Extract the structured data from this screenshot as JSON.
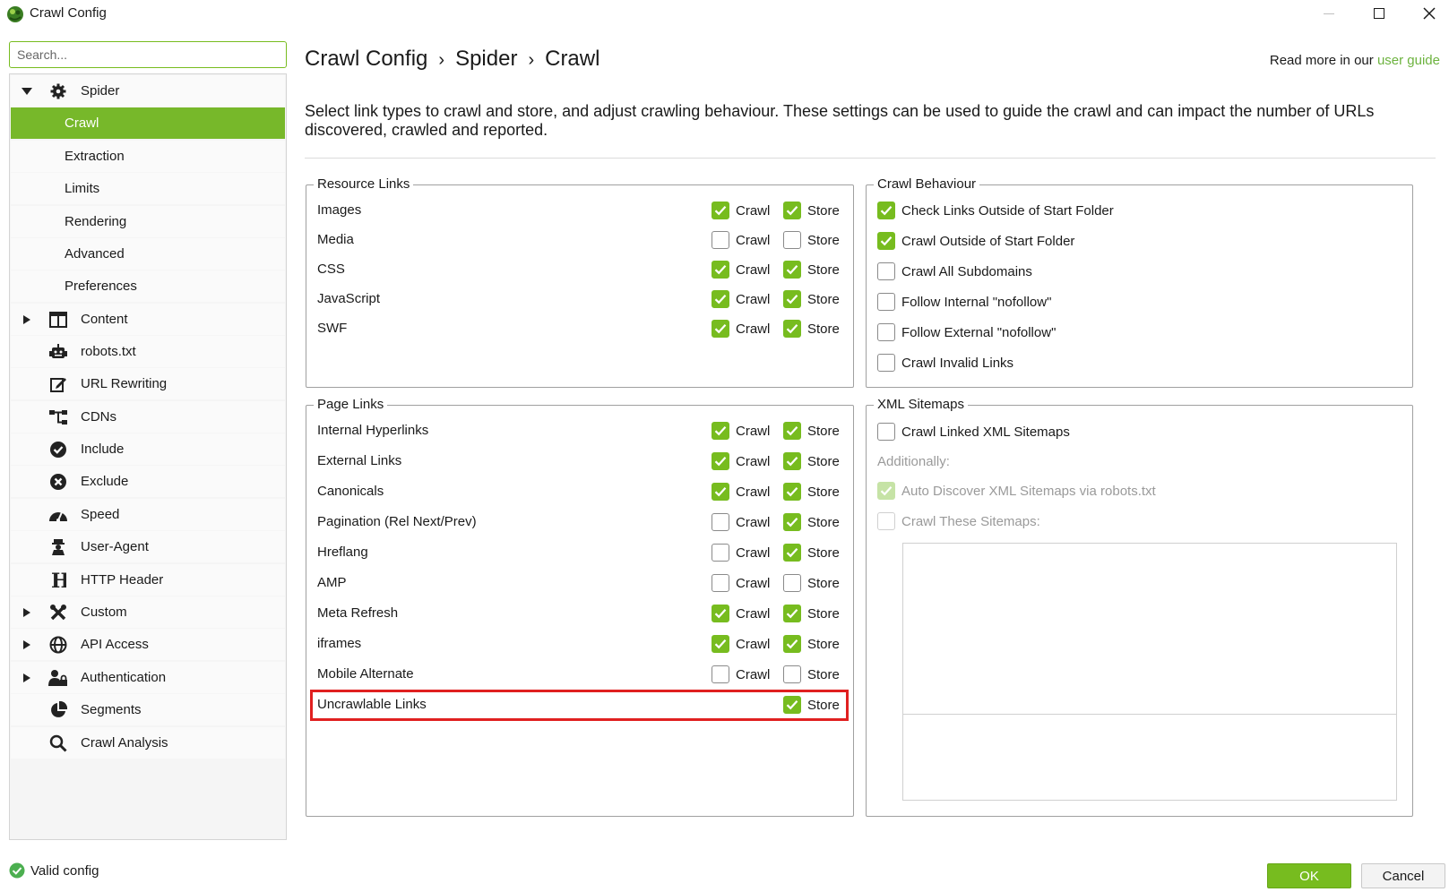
{
  "window": {
    "title": "Crawl Config",
    "controls": [
      "minimize-icon",
      "maximize-icon",
      "close-icon"
    ]
  },
  "search": {
    "placeholder": "Search...",
    "value": ""
  },
  "sidebar": {
    "items": [
      {
        "label": "Spider",
        "icon": "gear-icon",
        "expanded": true,
        "level": 1
      },
      {
        "label": "Crawl",
        "level": 2,
        "selected": true
      },
      {
        "label": "Extraction",
        "level": 2
      },
      {
        "label": "Limits",
        "level": 2
      },
      {
        "label": "Rendering",
        "level": 2
      },
      {
        "label": "Advanced",
        "level": 2
      },
      {
        "label": "Preferences",
        "level": 2
      },
      {
        "label": "Content",
        "icon": "columns-icon",
        "expandable": true,
        "level": 1
      },
      {
        "label": "robots.txt",
        "icon": "robot-icon",
        "level": 1
      },
      {
        "label": "URL Rewriting",
        "icon": "edit-icon",
        "level": 1
      },
      {
        "label": "CDNs",
        "icon": "network-icon",
        "level": 1
      },
      {
        "label": "Include",
        "icon": "check-circle-icon",
        "level": 1
      },
      {
        "label": "Exclude",
        "icon": "x-circle-icon",
        "level": 1
      },
      {
        "label": "Speed",
        "icon": "speedometer-icon",
        "level": 1
      },
      {
        "label": "User-Agent",
        "icon": "user-agent-icon",
        "level": 1
      },
      {
        "label": "HTTP Header",
        "icon": "letter-h-icon",
        "level": 1
      },
      {
        "label": "Custom",
        "icon": "tools-icon",
        "expandable": true,
        "level": 1
      },
      {
        "label": "API Access",
        "icon": "globe-icon",
        "expandable": true,
        "level": 1
      },
      {
        "label": "Authentication",
        "icon": "user-lock-icon",
        "expandable": true,
        "level": 1
      },
      {
        "label": "Segments",
        "icon": "pie-chart-icon",
        "level": 1
      },
      {
        "label": "Crawl Analysis",
        "icon": "magnifier-icon",
        "level": 1
      }
    ]
  },
  "status": {
    "text": "Valid config",
    "icon": "valid-check-icon"
  },
  "header": {
    "breadcrumb": [
      "Crawl Config",
      "Spider",
      "Crawl"
    ],
    "separator": "›",
    "read_more_prefix": "Read more in our",
    "read_more_link": "user guide"
  },
  "description": "Select link types to crawl and store, and adjust crawling behaviour. These settings can be used to guide the crawl and can impact the number of URLs discovered, crawled and reported.",
  "labels": {
    "crawl": "Crawl",
    "store": "Store"
  },
  "resource_links": {
    "title": "Resource Links",
    "rows": [
      {
        "label": "Images",
        "crawl": true,
        "store": true
      },
      {
        "label": "Media",
        "crawl": false,
        "store": false
      },
      {
        "label": "CSS",
        "crawl": true,
        "store": true
      },
      {
        "label": "JavaScript",
        "crawl": true,
        "store": true
      },
      {
        "label": "SWF",
        "crawl": true,
        "store": true
      }
    ]
  },
  "page_links": {
    "title": "Page Links",
    "rows": [
      {
        "label": "Internal Hyperlinks",
        "crawl": true,
        "store": true
      },
      {
        "label": "External Links",
        "crawl": true,
        "store": true
      },
      {
        "label": "Canonicals",
        "crawl": true,
        "store": true
      },
      {
        "label": "Pagination (Rel Next/Prev)",
        "crawl": false,
        "store": true
      },
      {
        "label": "Hreflang",
        "crawl": false,
        "store": true
      },
      {
        "label": "AMP",
        "crawl": false,
        "store": false
      },
      {
        "label": "Meta Refresh",
        "crawl": true,
        "store": true
      },
      {
        "label": "iframes",
        "crawl": true,
        "store": true
      },
      {
        "label": "Mobile Alternate",
        "crawl": false,
        "store": false
      },
      {
        "label": "Uncrawlable Links",
        "crawl": null,
        "store": true,
        "highlighted": true
      }
    ]
  },
  "crawl_behaviour": {
    "title": "Crawl Behaviour",
    "options": [
      {
        "label": "Check Links Outside of Start Folder",
        "checked": true
      },
      {
        "label": "Crawl Outside of Start Folder",
        "checked": true
      },
      {
        "label": "Crawl All Subdomains",
        "checked": false
      },
      {
        "label": "Follow Internal \"nofollow\"",
        "checked": false
      },
      {
        "label": "Follow External \"nofollow\"",
        "checked": false
      },
      {
        "label": "Crawl Invalid Links",
        "checked": false
      }
    ]
  },
  "xml_sitemaps": {
    "title": "XML Sitemaps",
    "crawl_linked": {
      "label": "Crawl Linked XML Sitemaps",
      "checked": false
    },
    "additionally": "Additionally:",
    "auto_discover": {
      "label": "Auto Discover XML Sitemaps via robots.txt",
      "checked": true,
      "disabled": true
    },
    "crawl_these": {
      "label": "Crawl These Sitemaps:",
      "checked": false,
      "disabled": true
    },
    "sitemaps_text": ""
  },
  "buttons": {
    "ok": "OK",
    "cancel": "Cancel"
  },
  "colors": {
    "accent": "#77bc1f",
    "selected_row": "#77b82a",
    "link": "#6db33f",
    "highlight_border": "#e02020"
  }
}
